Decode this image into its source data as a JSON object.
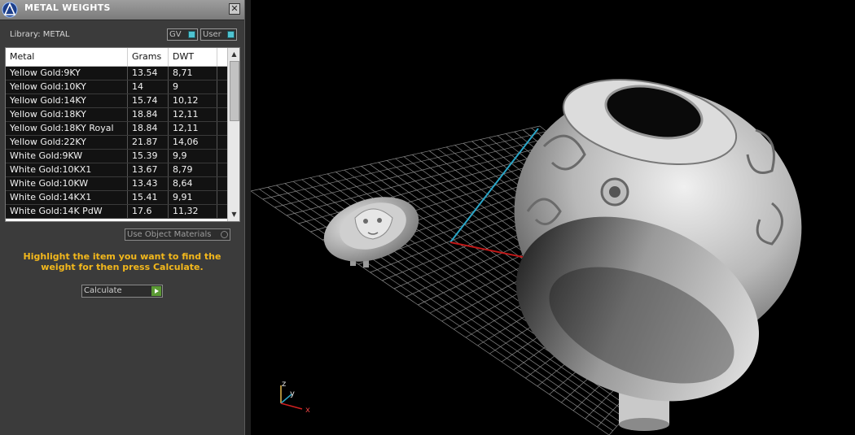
{
  "panel": {
    "title": "METAL WEIGHTS",
    "close_glyph": "✕",
    "library_label": "Library: METAL",
    "toggles": [
      {
        "label": "GV",
        "state": "on"
      },
      {
        "label": "User",
        "state": "on"
      }
    ],
    "table": {
      "columns": [
        "Metal",
        "Grams",
        "DWT"
      ],
      "rows": [
        {
          "metal": "Yellow Gold:9KY",
          "grams": "13.54",
          "dwt": "8,71"
        },
        {
          "metal": "Yellow Gold:10KY",
          "grams": "14",
          "dwt": "9"
        },
        {
          "metal": "Yellow Gold:14KY",
          "grams": "15.74",
          "dwt": "10,12"
        },
        {
          "metal": "Yellow Gold:18KY",
          "grams": "18.84",
          "dwt": "12,11"
        },
        {
          "metal": "Yellow Gold:18KY Royal",
          "grams": "18.84",
          "dwt": "12,11"
        },
        {
          "metal": "Yellow Gold:22KY",
          "grams": "21.87",
          "dwt": "14,06"
        },
        {
          "metal": "White Gold:9KW",
          "grams": "15.39",
          "dwt": "9,9"
        },
        {
          "metal": "White Gold:10KX1",
          "grams": "13.67",
          "dwt": "8,79"
        },
        {
          "metal": "White Gold:10KW",
          "grams": "13.43",
          "dwt": "8,64"
        },
        {
          "metal": "White Gold:14KX1",
          "grams": "15.41",
          "dwt": "9,91"
        },
        {
          "metal": "White Gold:14K PdW",
          "grams": "17.6",
          "dwt": "11,32"
        }
      ],
      "scroll_up_icon": "▲",
      "scroll_down_icon": "▼"
    },
    "use_object_materials_label": "Use Object Materials",
    "instructions": "Highlight the item you want to find the weight for then press Calculate.",
    "calculate_label": "Calculate",
    "accent_color": "#f3b81c"
  },
  "viewport": {
    "axis_labels": {
      "z": "z",
      "y": "y",
      "x": "x"
    },
    "colors": {
      "x_axis": "#d02020",
      "y_axis": "#2aa6c8",
      "z_axis": "#e2b84a",
      "grid": "#8a8a8a"
    },
    "objects": [
      "medusa-head-piece",
      "signet-ring"
    ]
  }
}
